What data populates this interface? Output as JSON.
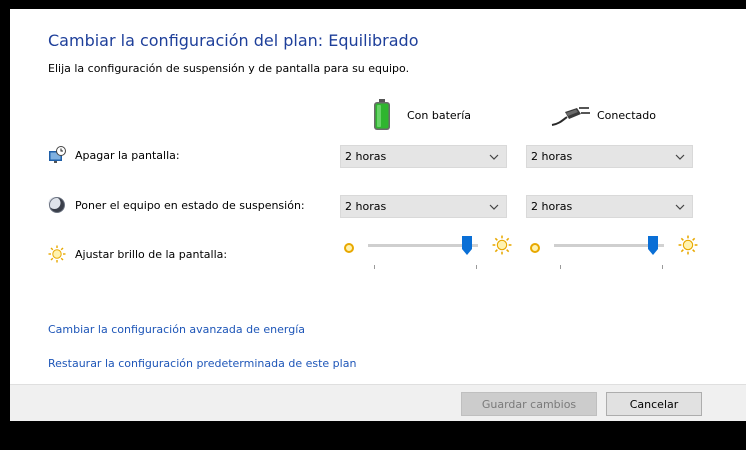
{
  "header": {
    "title": "Cambiar la configuración del plan: Equilibrado",
    "subtitle": "Elija la configuración de suspensión y de pantalla para su equipo."
  },
  "columns": {
    "battery": {
      "label": "Con batería",
      "icon": "battery-icon"
    },
    "plugged": {
      "label": "Conectado",
      "icon": "power-plug-icon"
    }
  },
  "rows": {
    "display": {
      "label": "Apagar la pantalla:",
      "icon": "monitor-clock-icon",
      "battery_value": "2 horas",
      "plugged_value": "2 horas"
    },
    "sleep": {
      "label": "Poner el equipo en estado de suspensión:",
      "icon": "moon-sleep-icon",
      "battery_value": "2 horas",
      "plugged_value": "2 horas"
    },
    "brightness": {
      "label": "Ajustar brillo de la pantalla:",
      "icon": "sun-brightness-icon",
      "battery_level": 0.9,
      "plugged_level": 0.9
    }
  },
  "links": {
    "advanced": "Cambiar la configuración avanzada de energía",
    "restore": "Restaurar la configuración predeterminada de este plan"
  },
  "buttons": {
    "save": "Guardar cambios",
    "cancel": "Cancelar"
  },
  "colors": {
    "title": "#1e3f9a",
    "link": "#1e56b8",
    "slider_thumb": "#0a6fd6",
    "sun": "#e8a800"
  }
}
